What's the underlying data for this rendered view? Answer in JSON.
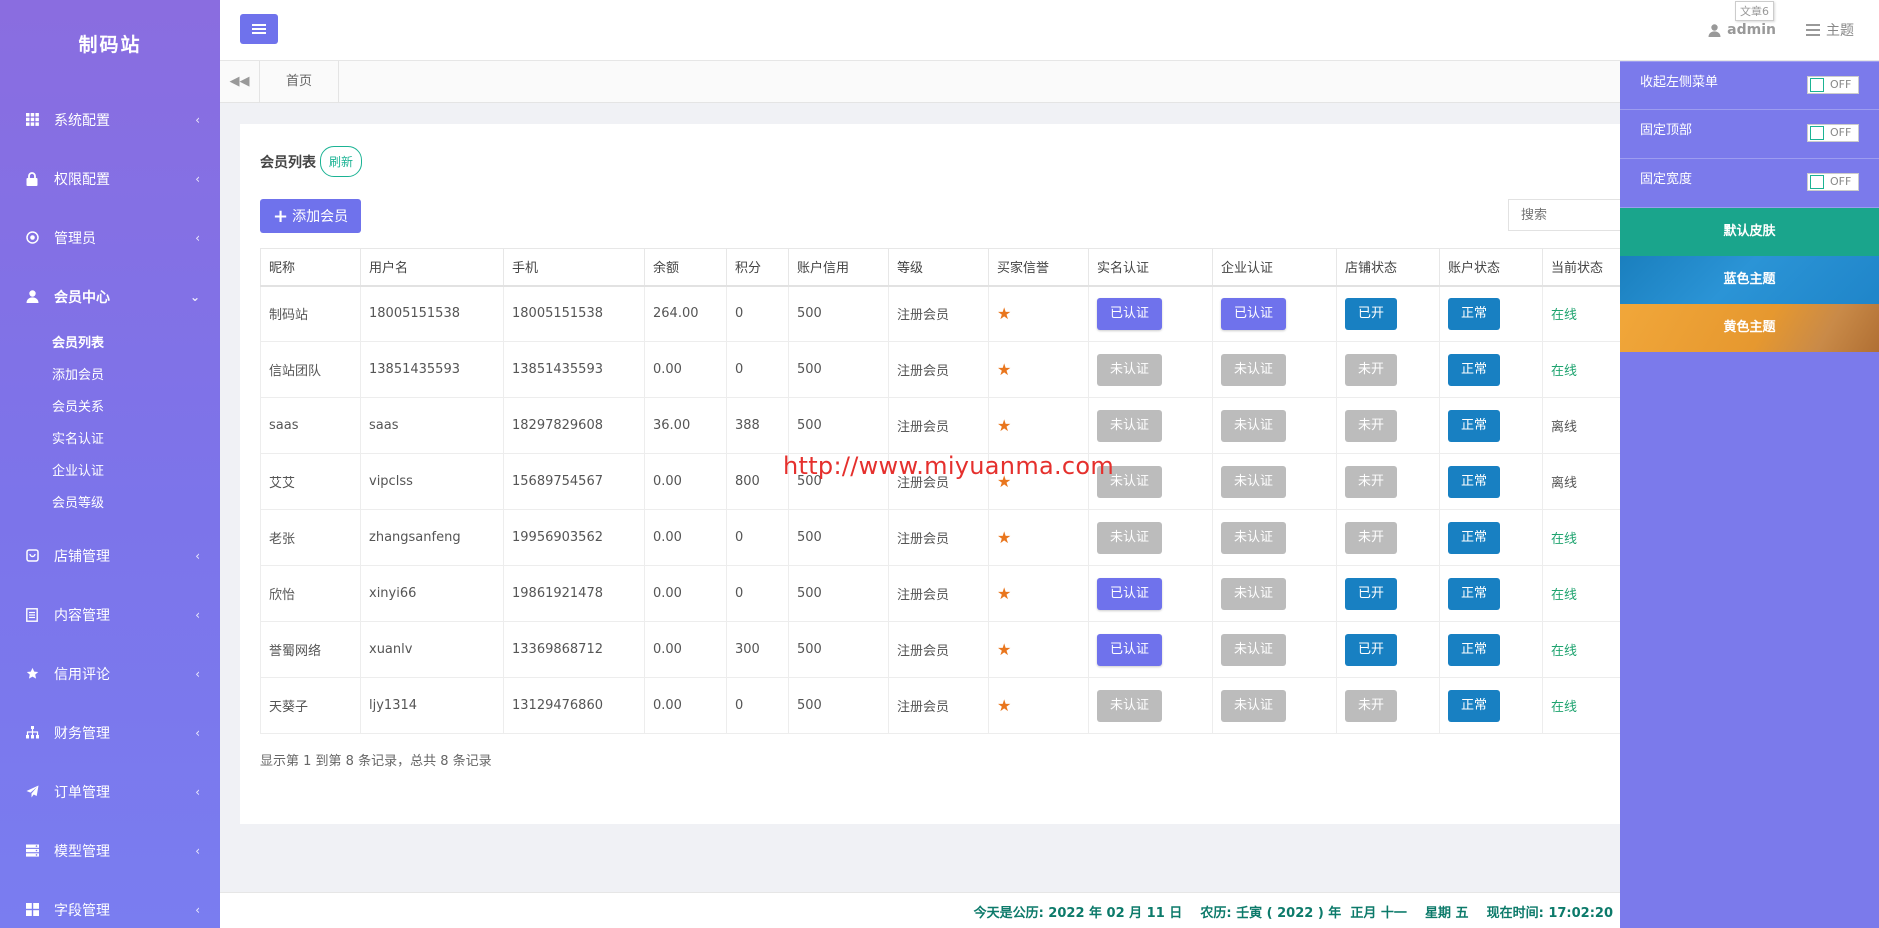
{
  "brand": "制码站",
  "sidebar": {
    "items": [
      {
        "label": "系统配置",
        "icon": "grid-icon"
      },
      {
        "label": "权限配置",
        "icon": "lock-icon"
      },
      {
        "label": "管理员",
        "icon": "dot-circle-icon"
      },
      {
        "label": "会员中心",
        "icon": "user-icon"
      },
      {
        "label": "店铺管理",
        "icon": "store-icon"
      },
      {
        "label": "内容管理",
        "icon": "document-icon"
      },
      {
        "label": "信用评论",
        "icon": "star-icon"
      },
      {
        "label": "财务管理",
        "icon": "sitemap-icon"
      },
      {
        "label": "订单管理",
        "icon": "paper-plane-icon"
      },
      {
        "label": "模型管理",
        "icon": "server-icon"
      },
      {
        "label": "字段管理",
        "icon": "grid-icon"
      }
    ],
    "submenu": [
      "会员列表",
      "添加会员",
      "会员关系",
      "实名认证",
      "企业认证",
      "会员等级"
    ]
  },
  "topbar": {
    "user": "admin",
    "theme_label": "主题",
    "tooltip": "文章6"
  },
  "tabs": {
    "home": "首页"
  },
  "panel": {
    "title": "会员列表",
    "refresh": "刷新",
    "add_button": "添加会员",
    "search_placeholder": "搜索",
    "pager_info": "显示第 1 到第 8 条记录，总共 8 条记录"
  },
  "table": {
    "columns": [
      "昵称",
      "用户名",
      "手机",
      "余额",
      "积分",
      "账户信用",
      "等级",
      "买家信誉",
      "实名认证",
      "企业认证",
      "店铺状态",
      "账户状态",
      "当前状态"
    ],
    "rows": [
      {
        "nickname": "制码站",
        "username": "18005151538",
        "phone": "18005151538",
        "balance": "264.00",
        "points": "0",
        "credit": "500",
        "level": "注册会员",
        "realname": "已认证",
        "realname_ok": true,
        "company": "已认证",
        "company_ok": true,
        "shop": "已开",
        "shop_open": true,
        "account": "正常",
        "status": "在线",
        "online": true
      },
      {
        "nickname": "信站团队",
        "username": "13851435593",
        "phone": "13851435593",
        "balance": "0.00",
        "points": "0",
        "credit": "500",
        "level": "注册会员",
        "realname": "未认证",
        "realname_ok": false,
        "company": "未认证",
        "company_ok": false,
        "shop": "未开",
        "shop_open": false,
        "account": "正常",
        "status": "在线",
        "online": true
      },
      {
        "nickname": "saas",
        "username": "saas",
        "phone": "18297829608",
        "balance": "36.00",
        "points": "388",
        "credit": "500",
        "level": "注册会员",
        "realname": "未认证",
        "realname_ok": false,
        "company": "未认证",
        "company_ok": false,
        "shop": "未开",
        "shop_open": false,
        "account": "正常",
        "status": "离线",
        "online": false
      },
      {
        "nickname": "艾艾",
        "username": "vipclss",
        "phone": "15689754567",
        "balance": "0.00",
        "points": "800",
        "credit": "500",
        "level": "注册会员",
        "realname": "未认证",
        "realname_ok": false,
        "company": "未认证",
        "company_ok": false,
        "shop": "未开",
        "shop_open": false,
        "account": "正常",
        "status": "离线",
        "online": false
      },
      {
        "nickname": "老张",
        "username": "zhangsanfeng",
        "phone": "19956903562",
        "balance": "0.00",
        "points": "0",
        "credit": "500",
        "level": "注册会员",
        "realname": "未认证",
        "realname_ok": false,
        "company": "未认证",
        "company_ok": false,
        "shop": "未开",
        "shop_open": false,
        "account": "正常",
        "status": "在线",
        "online": true
      },
      {
        "nickname": "欣怡",
        "username": "xinyi66",
        "phone": "19861921478",
        "balance": "0.00",
        "points": "0",
        "credit": "500",
        "level": "注册会员",
        "realname": "已认证",
        "realname_ok": true,
        "company": "未认证",
        "company_ok": false,
        "shop": "已开",
        "shop_open": true,
        "account": "正常",
        "status": "在线",
        "online": true
      },
      {
        "nickname": "誉蜀网络",
        "username": "xuanlv",
        "phone": "13369868712",
        "balance": "0.00",
        "points": "300",
        "credit": "500",
        "level": "注册会员",
        "realname": "已认证",
        "realname_ok": true,
        "company": "未认证",
        "company_ok": false,
        "shop": "已开",
        "shop_open": true,
        "account": "正常",
        "status": "在线",
        "online": true
      },
      {
        "nickname": "天葵子",
        "username": "ljy1314",
        "phone": "13129476860",
        "balance": "0.00",
        "points": "0",
        "credit": "500",
        "level": "注册会员",
        "realname": "未认证",
        "realname_ok": false,
        "company": "未认证",
        "company_ok": false,
        "shop": "未开",
        "shop_open": false,
        "account": "正常",
        "status": "在线",
        "online": true
      }
    ]
  },
  "watermark": "http://www.miyuanma.com",
  "footer": "今天是公历: 2022 年 02 月 11 日    农历: 壬寅 ( 2022 ) 年  正月 十一    星期 五    现在时间: 17:02:20",
  "theme_panel": {
    "options": [
      {
        "label": "收起左侧菜单",
        "state": "OFF"
      },
      {
        "label": "固定顶部",
        "state": "OFF"
      },
      {
        "label": "固定宽度",
        "state": "OFF"
      }
    ],
    "skins": [
      "默认皮肤",
      "蓝色主题",
      "黄色主题"
    ]
  },
  "colors": {
    "accent": "#6f72ec",
    "sidebar_top": "#8a6de0",
    "blue_badge": "#1880c2",
    "grey_badge": "#bcbcbc",
    "online": "#1ea36f",
    "star": "#e9761e",
    "teal": "#1bb394"
  }
}
